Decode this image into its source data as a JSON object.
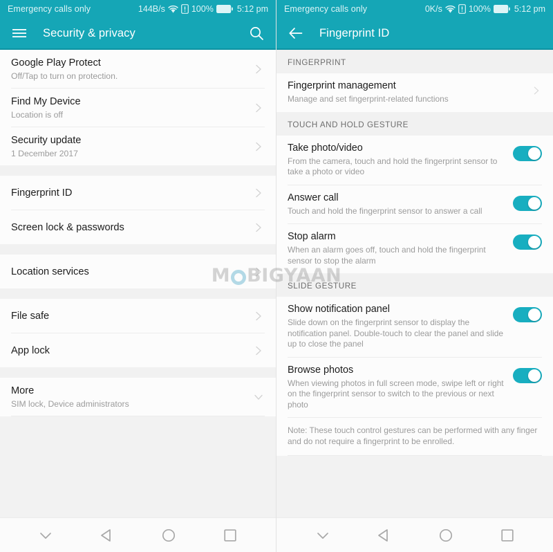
{
  "watermark": {
    "text_left": "M",
    "text_right": "BIGYAAN"
  },
  "left": {
    "status": {
      "carrier": "Emergency calls only",
      "network_speed": "144B/s",
      "battery_percent": "100%",
      "time": "5:12 pm",
      "icons": [
        "wifi-icon",
        "sim-alert-icon",
        "battery-icon"
      ]
    },
    "appbar": {
      "title": "Security & privacy",
      "menu_icon": "hamburger-menu-icon",
      "action_icon": "search-icon"
    },
    "groups": [
      {
        "items": [
          {
            "title": "Google Play Protect",
            "subtitle": "Off/Tap to turn on protection.",
            "accessory": "chevron-right-icon"
          },
          {
            "title": "Find My Device",
            "subtitle": "Location is off",
            "accessory": "chevron-right-icon"
          },
          {
            "title": "Security update",
            "subtitle": "1 December 2017",
            "accessory": "chevron-right-icon"
          }
        ]
      },
      {
        "items": [
          {
            "title": "Fingerprint ID",
            "subtitle": "",
            "accessory": "chevron-right-icon"
          },
          {
            "title": "Screen lock & passwords",
            "subtitle": "",
            "accessory": "chevron-right-icon"
          }
        ]
      },
      {
        "items": [
          {
            "title": "Location services",
            "subtitle": "",
            "accessory": "chevron-right-icon"
          }
        ]
      },
      {
        "items": [
          {
            "title": "File safe",
            "subtitle": "",
            "accessory": "chevron-right-icon"
          },
          {
            "title": "App lock",
            "subtitle": "",
            "accessory": "chevron-right-icon"
          }
        ]
      },
      {
        "items": [
          {
            "title": "More",
            "subtitle": "SIM lock, Device administrators",
            "accessory": "chevron-down-icon"
          }
        ]
      }
    ],
    "navbar": [
      "chevron-down-icon",
      "back-triangle-icon",
      "home-circle-icon",
      "recents-square-icon"
    ]
  },
  "right": {
    "status": {
      "carrier": "Emergency calls only",
      "network_speed": "0K/s",
      "battery_percent": "100%",
      "time": "5:12 pm",
      "icons": [
        "wifi-icon",
        "sim-alert-icon",
        "battery-icon"
      ]
    },
    "appbar": {
      "title": "Fingerprint ID",
      "menu_icon": "back-arrow-icon"
    },
    "sections": [
      {
        "header": "FINGERPRINT",
        "rows": [
          {
            "title": "Fingerprint management",
            "subtitle": "Manage and set fingerprint-related functions",
            "accessory": "chevron-right-icon"
          }
        ]
      },
      {
        "header": "TOUCH AND HOLD GESTURE",
        "rows": [
          {
            "title": "Take photo/video",
            "subtitle": "From the camera, touch and hold the fingerprint sensor to take a photo or video",
            "accessory": "toggle",
            "toggle_on": true
          },
          {
            "title": "Answer call",
            "subtitle": "Touch and hold the fingerprint sensor to answer a call",
            "accessory": "toggle",
            "toggle_on": true
          },
          {
            "title": "Stop alarm",
            "subtitle": "When an alarm goes off, touch and hold the fingerprint sensor to stop the alarm",
            "accessory": "toggle",
            "toggle_on": true
          }
        ]
      },
      {
        "header": "SLIDE GESTURE",
        "rows": [
          {
            "title": "Show notification panel",
            "subtitle": "Slide down on the fingerprint sensor to display the notification panel. Double-touch to clear the panel and slide up to close the panel",
            "accessory": "toggle",
            "toggle_on": true
          },
          {
            "title": "Browse photos",
            "subtitle": "When viewing photos in full screen mode, swipe left or right on the fingerprint sensor to switch to the previous or next photo",
            "accessory": "toggle",
            "toggle_on": true
          }
        ],
        "note": "Note: These touch control gestures can be performed with any finger and do not require a fingerprint to be enrolled."
      }
    ],
    "navbar": [
      "chevron-down-icon",
      "back-triangle-icon",
      "home-circle-icon",
      "recents-square-icon"
    ]
  },
  "colors": {
    "accent_teal": "#15a6b6",
    "toggle_on": "#18aec0",
    "page_bg": "#f1f1f1",
    "card_bg": "#fcfcfc"
  }
}
